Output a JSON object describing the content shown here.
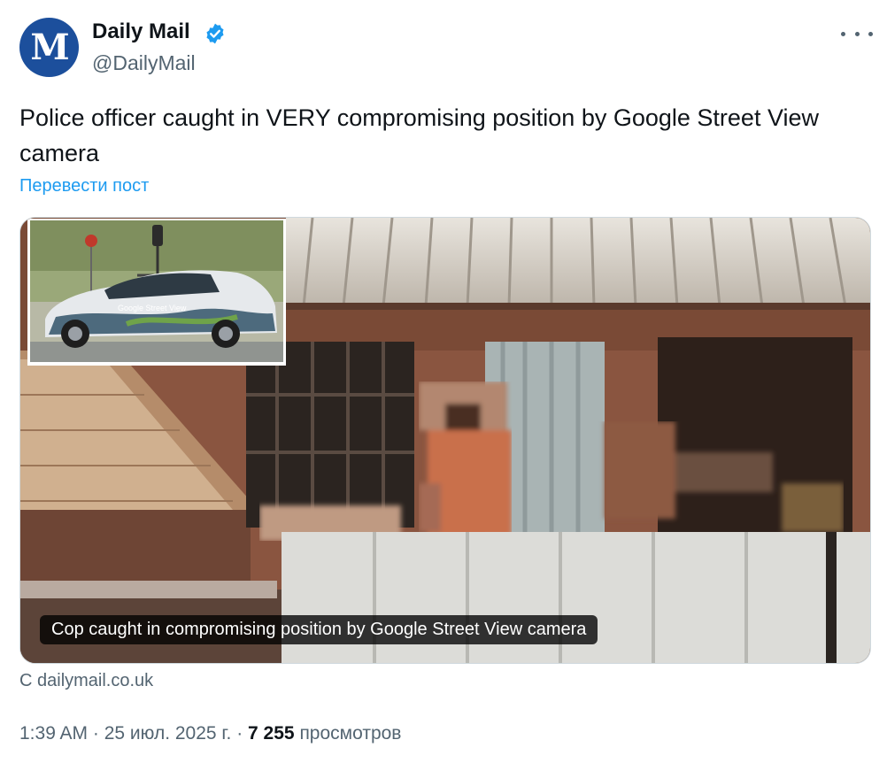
{
  "account": {
    "name": "Daily Mail",
    "handle": "@DailyMail",
    "avatar_glyph": "M",
    "avatar_color": "#1c4f9c",
    "verified_icon": "verified-badge-icon",
    "verified_color": "#1d9bf0"
  },
  "menu": {
    "icon": "more-dots-icon"
  },
  "tweet": {
    "text": "Police officer caught in VERY compromising position by Google Street View camera",
    "translate_label": "Перевести пост"
  },
  "media": {
    "inset_text": "Google Street View",
    "caption": "Cop caught in compromising position by Google Street View camera"
  },
  "source": "С dailymail.co.uk",
  "meta": {
    "time": "1:39 AM",
    "separator": " · ",
    "date": "25 июл. 2025 г.",
    "views_count": "7 255",
    "views_label": "просмотров"
  },
  "colors": {
    "link": "#1d9bf0",
    "secondary_text": "#536471",
    "primary_text": "#0f1419",
    "border": "#cfd9de"
  }
}
